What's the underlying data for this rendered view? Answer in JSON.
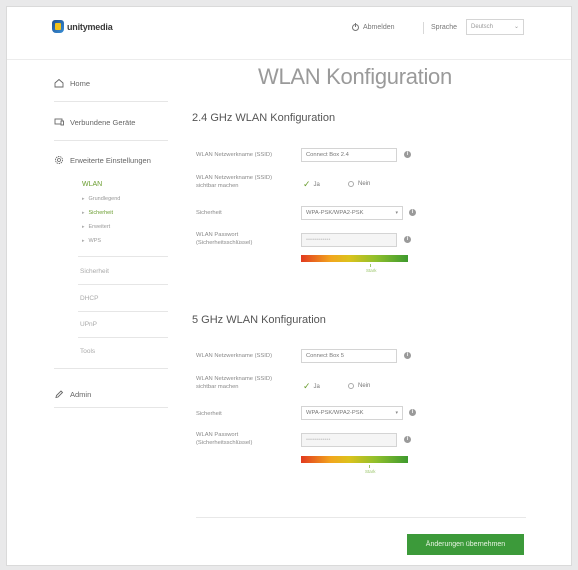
{
  "header": {
    "logo_text": "unitymedia",
    "logout_label": "Abmelden",
    "language_label": "Sprache",
    "language_value": "Deutsch"
  },
  "sidebar": {
    "home": "Home",
    "connected_devices": "Verbundene Geräte",
    "advanced_settings": "Erweiterte Einstellungen",
    "wlan": "WLAN",
    "wlan_sub": [
      "Grundlegend",
      "Sicherheit",
      "Erweitert",
      "WPS"
    ],
    "security": "Sicherheit",
    "dhcp": "DHCP",
    "upnp": "UPnP",
    "tools": "Tools",
    "admin": "Admin"
  },
  "main": {
    "title": "WLAN Konfiguration",
    "band24": {
      "title": "2.4 GHz WLAN Konfiguration",
      "ssid_label": "WLAN Netzwerkname (SSID)",
      "ssid_value": "Connect Box 2.4",
      "visible_label": "WLAN Netzwerkname (SSID) sichtbar machen",
      "yes_label": "Ja",
      "no_label": "Nein",
      "security_label": "Sicherheit",
      "security_value": "WPA-PSK/WPA2-PSK",
      "password_label": "WLAN Passwort (Sicherheitsschlüssel)",
      "password_value": "••••••••••••",
      "strength_label": "Stark",
      "strength_level": 0.7
    },
    "band5": {
      "title": "5 GHz WLAN Konfiguration",
      "ssid_label": "WLAN Netzwerkname (SSID)",
      "ssid_value": "Connect Box 5",
      "visible_label": "WLAN Netzwerkname (SSID) sichtbar machen",
      "yes_label": "Ja",
      "no_label": "Nein",
      "security_label": "Sicherheit",
      "security_value": "WPA-PSK/WPA2-PSK",
      "password_label": "WLAN Passwort (Sicherheitsschlüssel)",
      "password_value": "••••••••••••",
      "strength_label": "Stark",
      "strength_level": 0.65
    },
    "apply_label": "Änderungen übernehmen"
  },
  "colors": {
    "accent_green": "#3c9a3a",
    "active_nav": "#6a9d2f"
  }
}
